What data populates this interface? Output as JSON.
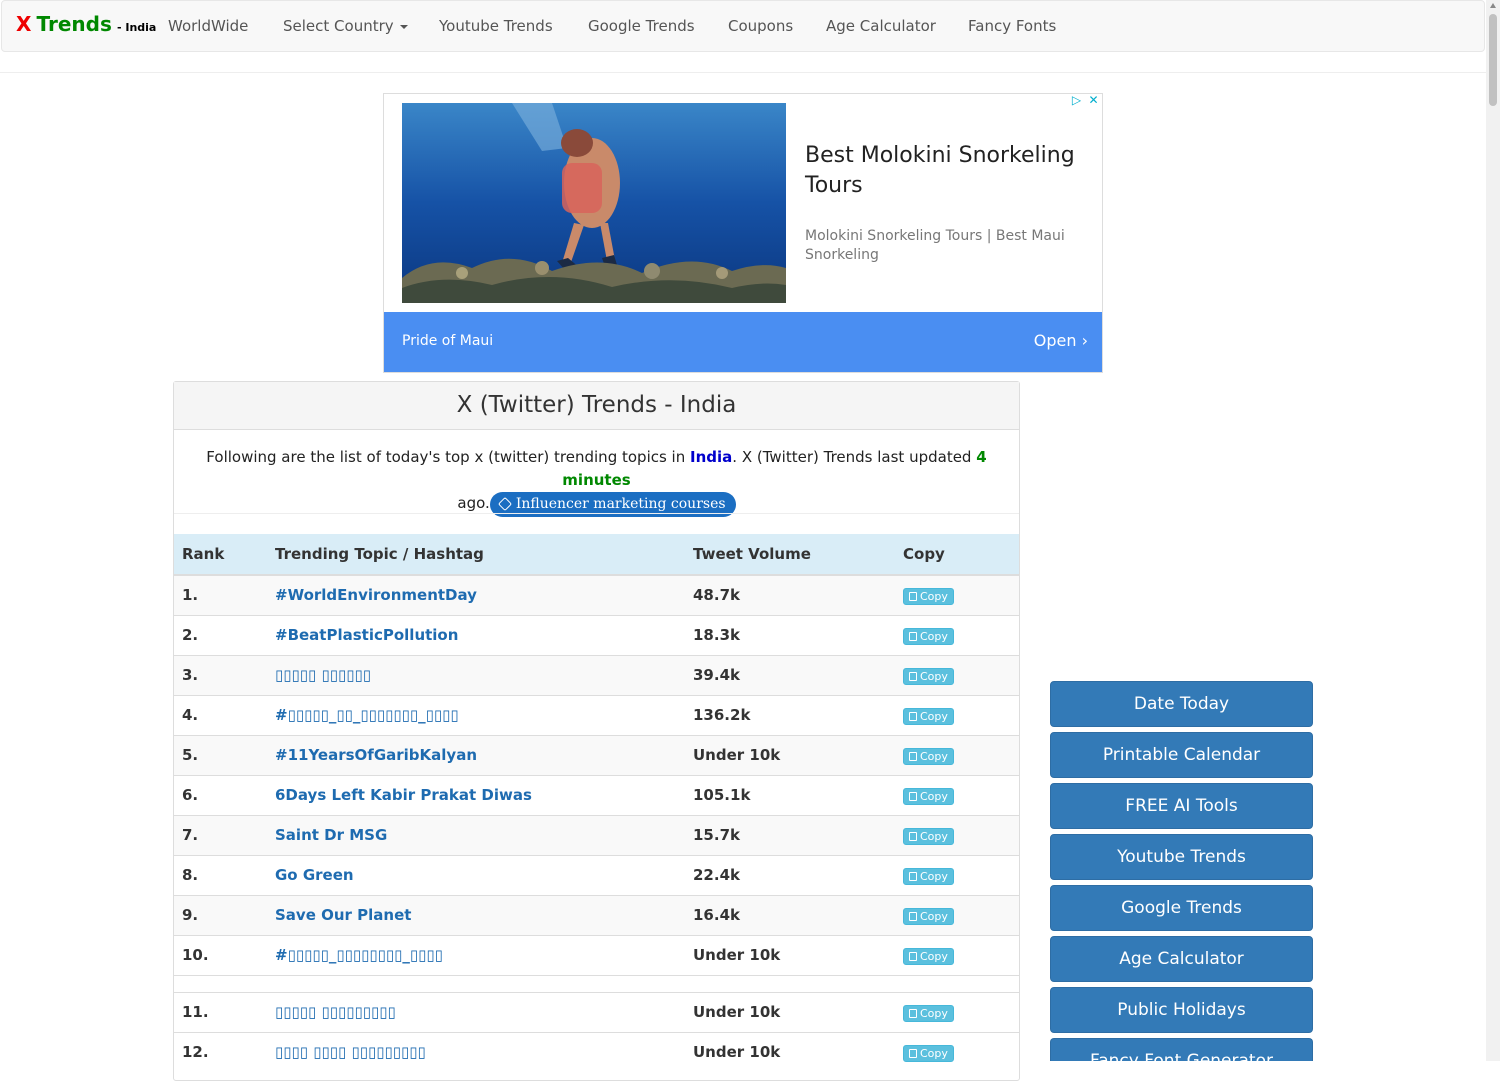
{
  "brand": {
    "x": "X",
    "trends": "Trends",
    "sub": "- India"
  },
  "nav": {
    "worldwide": "WorldWide",
    "select_country": "Select Country",
    "youtube": "Youtube Trends",
    "google": "Google Trends",
    "coupons": "Coupons",
    "age": "Age Calculator",
    "fancy": "Fancy Fonts"
  },
  "ad": {
    "title": "Best Molokini Snorkeling Tours",
    "desc": "Molokini Snorkeling Tours | Best Maui Snorkeling",
    "advertiser": "Pride of Maui",
    "cta": "Open",
    "colors": {
      "bar": "#4a8ef2",
      "icon": "#00aecd"
    }
  },
  "panel": {
    "title": "X (Twitter) Trends - India",
    "intro_1": "Following are the list of today's top x (twitter) trending topics in",
    "country": "India",
    "intro_2": ". X (Twitter) Trends last updated",
    "ago_value": "4 minutes",
    "intro_3": "ago.",
    "pill": "Influencer marketing courses"
  },
  "table": {
    "headers": {
      "rank": "Rank",
      "topic": "Trending Topic / Hashtag",
      "volume": "Tweet Volume",
      "copy": "Copy"
    },
    "copy_label": "Copy",
    "rows": [
      {
        "rank": "1.",
        "topic": "#WorldEnvironmentDay",
        "volume": "48.7k"
      },
      {
        "rank": "2.",
        "topic": "#BeatPlasticPollution",
        "volume": "18.3k"
      },
      {
        "rank": "3.",
        "topic": "▯▯▯▯▯ ▯▯▯▯▯▯",
        "volume": "39.4k"
      },
      {
        "rank": "4.",
        "topic": "#▯▯▯▯▯_▯▯_▯▯▯▯▯▯▯_▯▯▯▯",
        "volume": "136.2k"
      },
      {
        "rank": "5.",
        "topic": "#11YearsOfGaribKalyan",
        "volume": "Under 10k"
      },
      {
        "rank": "6.",
        "topic": "6Days Left Kabir Prakat Diwas",
        "volume": "105.1k"
      },
      {
        "rank": "7.",
        "topic": "Saint Dr MSG",
        "volume": "15.7k"
      },
      {
        "rank": "8.",
        "topic": "Go Green",
        "volume": "22.4k"
      },
      {
        "rank": "9.",
        "topic": "Save Our Planet",
        "volume": "16.4k"
      },
      {
        "rank": "10.",
        "topic": "#▯▯▯▯▯_▯▯▯▯▯▯▯▯_▯▯▯▯",
        "volume": "Under 10k"
      },
      {
        "rank": "11.",
        "topic": "▯▯▯▯▯ ▯▯▯▯▯▯▯▯▯",
        "volume": "Under 10k"
      },
      {
        "rank": "12.",
        "topic": "▯▯▯▯ ▯▯▯▯ ▯▯▯▯▯▯▯▯▯",
        "volume": "Under 10k"
      }
    ]
  },
  "sidebar": {
    "buttons": [
      "Date Today",
      "Printable Calendar",
      "FREE AI Tools",
      "Youtube Trends",
      "Google Trends",
      "Age Calculator",
      "Public Holidays",
      "Fancy Font Generator"
    ]
  },
  "colors": {
    "brand_red": "#ee0000",
    "brand_green": "#008800",
    "link": "#1e6bb0",
    "primary": "#337ab7",
    "info": "#5bc0de",
    "table_head": "#d9edf7"
  }
}
